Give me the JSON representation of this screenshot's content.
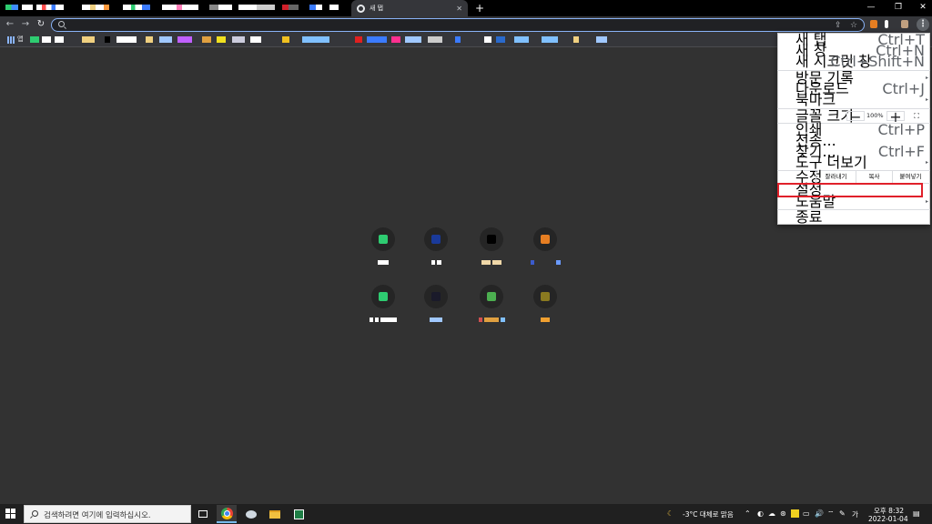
{
  "browser": {
    "active_tab": {
      "title": "새 탭",
      "close": "✕"
    },
    "new_tab": "+",
    "window_controls": {
      "minimize": "—",
      "restore": "❐",
      "close": "✕"
    },
    "toolbar": {
      "back": "←",
      "forward": "→",
      "reload": "↻",
      "share": "⇪",
      "star": "☆",
      "menu": "⋮"
    },
    "bookmarks": {
      "apps_label": "앱"
    }
  },
  "menu": {
    "items": [
      {
        "label": "새 탭",
        "shortcut": "Ctrl+T"
      },
      {
        "label": "새 창",
        "shortcut": "Ctrl+N"
      },
      {
        "label": "새 시크릿 창",
        "shortcut": "Ctrl+Shift+N"
      },
      {
        "label": "방문 기록",
        "arrow": "▸"
      },
      {
        "label": "다운로드",
        "shortcut": "Ctrl+J"
      },
      {
        "label": "북마크",
        "arrow": "▸"
      },
      {
        "label": "인쇄",
        "shortcut": "Ctrl+P"
      },
      {
        "label": "전송..."
      },
      {
        "label": "찾기...",
        "shortcut": "Ctrl+F"
      },
      {
        "label": "도구 더보기",
        "arrow": "▸"
      },
      {
        "label": "설정"
      },
      {
        "label": "도움말",
        "arrow": "▸"
      },
      {
        "label": "종료"
      }
    ],
    "zoom": {
      "label": "글꼴 크기",
      "minus": "−",
      "value": "100%",
      "plus": "+",
      "fullscreen": "⛶"
    },
    "edit": {
      "label": "수정",
      "cut": "잘라내기",
      "copy": "복사",
      "paste": "붙여넣기"
    }
  },
  "taskbar": {
    "search_placeholder": "검색하려면 여기에 입력하십시오.",
    "weather": "-3°C  대체로 맑음",
    "ime": "가",
    "time": "오후 8:32",
    "date": "2022-01-04"
  },
  "colors": {
    "page_bg": "#323232",
    "accent_focus": "#8ab4f8",
    "highlight": "#e0202a"
  }
}
